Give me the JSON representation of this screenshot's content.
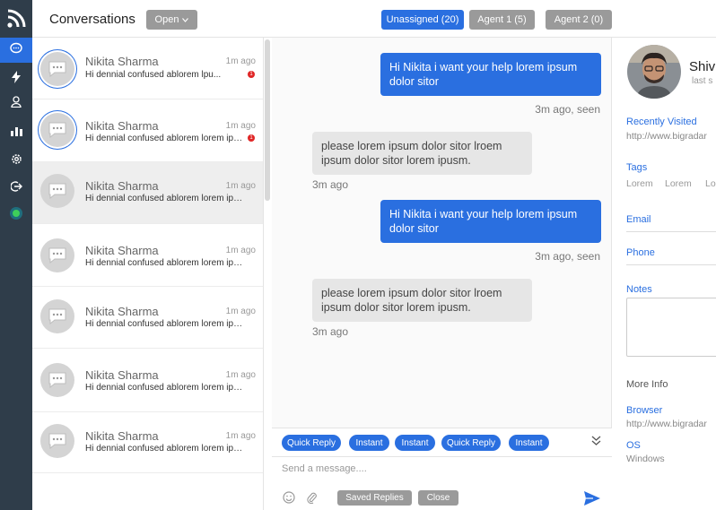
{
  "rail": {
    "items": [
      {
        "icon": "chat-bubble-icon",
        "active": true
      },
      {
        "icon": "lightning-icon",
        "active": false
      },
      {
        "icon": "user-icon",
        "active": false
      },
      {
        "icon": "bar-chart-icon",
        "active": false
      },
      {
        "icon": "gear-icon",
        "active": false
      },
      {
        "icon": "logout-icon",
        "active": false
      },
      {
        "icon": "status-online-icon",
        "active": false
      }
    ]
  },
  "header": {
    "title": "Conversations",
    "filter_label": "Open",
    "chips": {
      "unassigned": "Unassigned (20)",
      "agent1": "Agent 1 (5)",
      "agent2": "Agent 2 (0)"
    }
  },
  "conversations": [
    {
      "name": "Nikita Sharma",
      "time": "1m ago",
      "preview": "Hi dennial confused ablorem lpu...",
      "unread": "1",
      "ring": true
    },
    {
      "name": "Nikita Sharma",
      "time": "1m ago",
      "preview": "Hi dennial confused ablorem lorem ipsu...",
      "unread": "1",
      "ring": true
    },
    {
      "name": "Nikita Sharma",
      "time": "1m ago",
      "preview": "Hi dennial confused ablorem lorem ipu...",
      "selected": true
    },
    {
      "name": "Nikita Sharma",
      "time": "1m ago",
      "preview": "Hi dennial confused ablorem lorem ipsu..."
    },
    {
      "name": "Nikita Sharma",
      "time": "1m ago",
      "preview": "Hi dennial confused ablorem lorem ipsu..."
    },
    {
      "name": "Nikita Sharma",
      "time": "1m ago",
      "preview": "Hi dennial confused ablorem lorem ipu..."
    },
    {
      "name": "Nikita Sharma",
      "time": "1m ago",
      "preview": "Hi dennial confused ablorem lorem ipsu..."
    }
  ],
  "messages": [
    {
      "direction": "out",
      "text": "Hi Nikita i want your help lorem ipsum dolor sitor",
      "meta": "3m ago, seen"
    },
    {
      "direction": "in",
      "text": "please lorem ipsum dolor sitor lroem ipsum dolor sitor lorem ipusm.",
      "meta": "3m ago"
    },
    {
      "direction": "out",
      "text": "Hi Nikita i want your help lorem ipsum dolor sitor",
      "meta": "3m ago, seen"
    },
    {
      "direction": "in",
      "text": "please lorem ipsum dolor sitor lroem ipsum dolor sitor lorem ipusm.",
      "meta": "3m ago"
    }
  ],
  "quick_replies": [
    "Quick Reply",
    "Instant",
    "Instant",
    "Quick Reply",
    "Instant"
  ],
  "composer": {
    "placeholder": "Send a message....",
    "saved_replies": "Saved Replies",
    "close": "Close"
  },
  "profile": {
    "name": "Shiv",
    "subtitle": "last s",
    "recently_visited_label": "Recently Visited",
    "recently_visited_value": "http://www.bigradar",
    "tags_label": "Tags",
    "tags": [
      "Lorem",
      "Lorem",
      "Lo"
    ],
    "email_label": "Email",
    "phone_label": "Phone",
    "notes_label": "Notes",
    "more_info_label": "More Info",
    "browser_label": "Browser",
    "browser_value": "http://www.bigradar",
    "os_label": "OS",
    "os_value": "Windows"
  },
  "colors": {
    "accent": "#2a6fe0",
    "rail": "#2f3d4a",
    "badge": "#e02626",
    "online": "#3ecf5a"
  }
}
